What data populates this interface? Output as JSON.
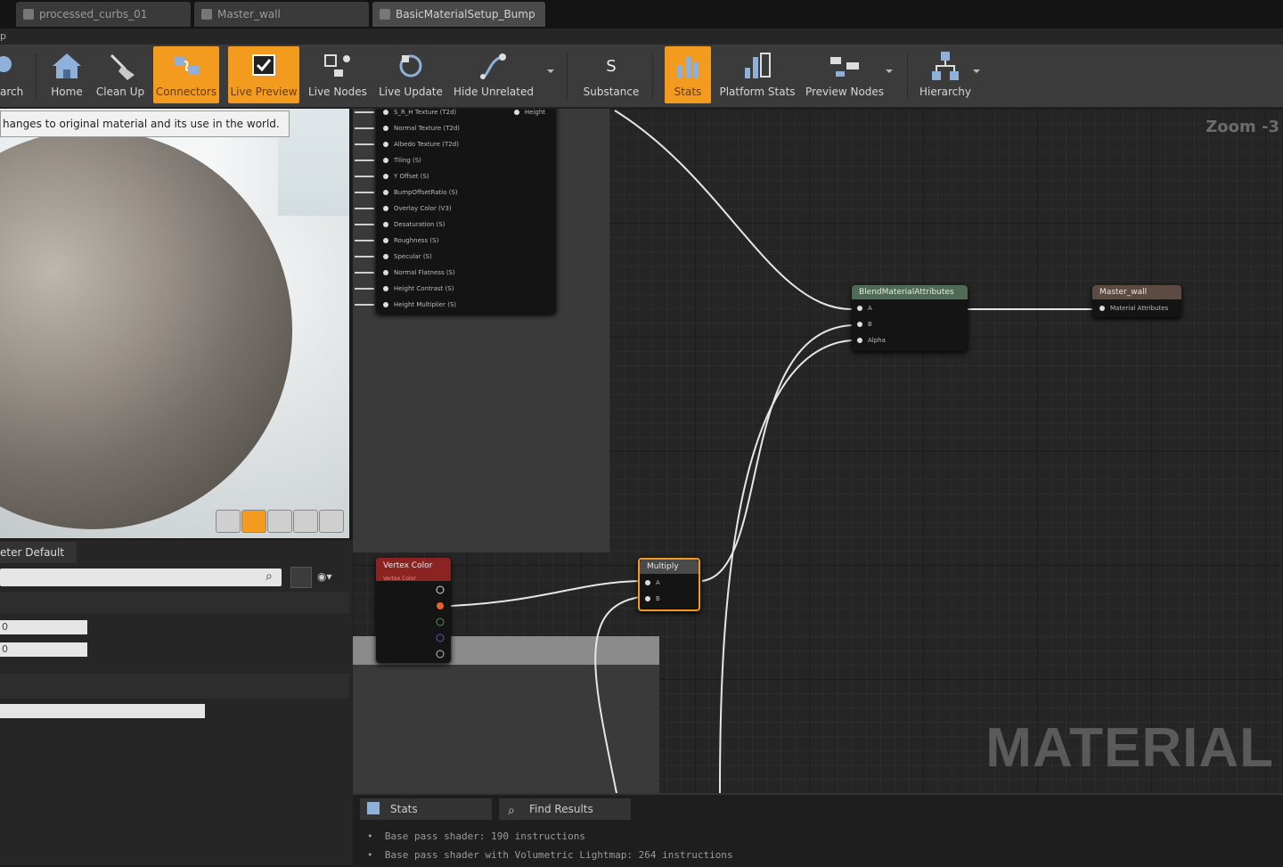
{
  "tabs": [
    {
      "label": "processed_curbs_01"
    },
    {
      "label": "Master_wall"
    },
    {
      "label": "BasicMaterialSetup_Bump"
    }
  ],
  "menu": {
    "fragment": "p"
  },
  "toolbar": {
    "items": [
      {
        "label": "arch",
        "icon": "search-icon"
      },
      {
        "label": "Home",
        "icon": "home-icon"
      },
      {
        "label": "Clean Up",
        "icon": "broom-icon"
      },
      {
        "label": "Connectors",
        "icon": "connectors-icon",
        "active": true
      },
      {
        "label": "Live Preview",
        "icon": "live-preview-icon",
        "active": true
      },
      {
        "label": "Live Nodes",
        "icon": "live-nodes-icon"
      },
      {
        "label": "Live Update",
        "icon": "live-update-icon"
      },
      {
        "label": "Hide Unrelated",
        "icon": "hide-unrelated-icon"
      },
      {
        "label": "Substance",
        "icon": "substance-icon"
      },
      {
        "label": "Stats",
        "icon": "stats-icon",
        "active": true
      },
      {
        "label": "Platform Stats",
        "icon": "platform-stats-icon"
      },
      {
        "label": "Preview Nodes",
        "icon": "preview-nodes-icon"
      },
      {
        "label": "Hierarchy",
        "icon": "hierarchy-icon"
      }
    ]
  },
  "viewport": {
    "tooltip": "hanges to original material and its use in the world."
  },
  "details": {
    "tab_label": "eter Default",
    "search_placeholder": "",
    "value1": "0",
    "value2": "0"
  },
  "graph": {
    "zoom": "Zoom -3",
    "watermark": "MATERIAL",
    "param_node": {
      "top_label": "Height",
      "pins": [
        "S_R_H Texture (T2d)",
        "Normal Texture (T2d)",
        "Albedo Texture (T2d)",
        "Tiling (S)",
        "Y Offset (S)",
        "BumpOffsetRatio (S)",
        "Overlay Color (V3)",
        "Desaturation (S)",
        "Roughness (S)",
        "Specular (S)",
        "Normal Flatness (S)",
        "Height Contrast (S)",
        "Height Multiplier (S)"
      ]
    },
    "blend_node": {
      "title": "BlendMaterialAttributes",
      "pins": [
        "A",
        "B",
        "Alpha"
      ]
    },
    "output_node": {
      "title": "Master_wall",
      "pin": "Material Attributes"
    },
    "vertex_node": {
      "title": "Vertex Color",
      "subtitle": "Vertex Color"
    },
    "multiply_node": {
      "title": "Multiply",
      "pins": [
        "A",
        "B"
      ]
    }
  },
  "bottom": {
    "tab_stats": "Stats",
    "tab_find": "Find Results",
    "lines": [
      "Base pass shader: 190 instructions",
      "Base pass shader with Volumetric Lightmap: 264 instructions"
    ]
  },
  "colors": {
    "accent": "#f39b1f",
    "blend_header": "#4f6a55",
    "output_header": "#5d4a40",
    "vertex_header": "#8c2323"
  }
}
